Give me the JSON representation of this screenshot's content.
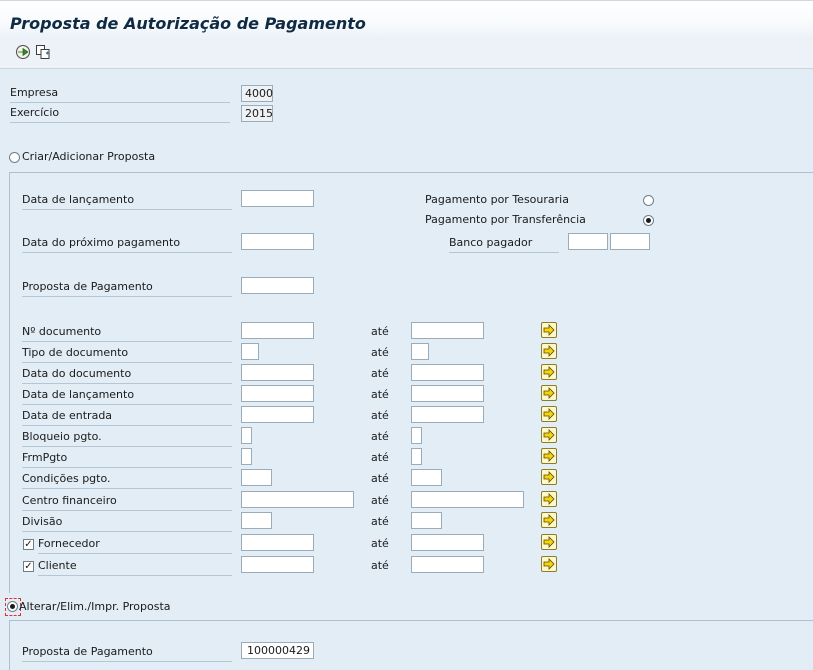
{
  "header": {
    "title": "Proposta de Autorização de Pagamento"
  },
  "toolbar": {
    "buttons": [
      "execute-icon",
      "copy-icon"
    ]
  },
  "top": {
    "empresa_label": "Empresa",
    "empresa_value": "4000",
    "exercicio_label": "Exercício",
    "exercicio_value": "2015"
  },
  "section1": {
    "radio_label": "Criar/Adicionar Proposta",
    "radio_selected": false,
    "data_lancamento_label": "Data de lançamento",
    "data_prox_pag_label": "Data do próximo pagamento",
    "proposta_pag_label": "Proposta de Pagamento",
    "pag_tesouraria_label": "Pagamento por Tesouraria",
    "pag_tesouraria_selected": false,
    "pag_transferencia_label": "Pagamento por Transferência",
    "pag_transferencia_selected": true,
    "banco_pagador_label": "Banco pagador",
    "range_sep": "até",
    "range_rows": [
      {
        "label": "Nº documento",
        "checkbox": false
      },
      {
        "label": "Tipo de documento",
        "checkbox": false
      },
      {
        "label": "Data do documento",
        "checkbox": false
      },
      {
        "label": "Data de lançamento",
        "checkbox": false
      },
      {
        "label": "Data de entrada",
        "checkbox": false
      },
      {
        "label": "Bloqueio pgto.",
        "checkbox": false
      },
      {
        "label": "FrmPgto",
        "checkbox": false
      },
      {
        "label": "Condições pgto.",
        "checkbox": false
      },
      {
        "label": "Centro financeiro",
        "checkbox": false
      },
      {
        "label": "Divisão",
        "checkbox": false
      },
      {
        "label": "Fornecedor",
        "checkbox": true,
        "checked": true
      },
      {
        "label": "Cliente",
        "checkbox": true,
        "checked": true
      }
    ]
  },
  "section2": {
    "radio_label": "Alterar/Elim./Impr. Proposta",
    "radio_selected": true,
    "proposta_pag_label": "Proposta de Pagamento",
    "proposta_pag_value": "100000429"
  }
}
